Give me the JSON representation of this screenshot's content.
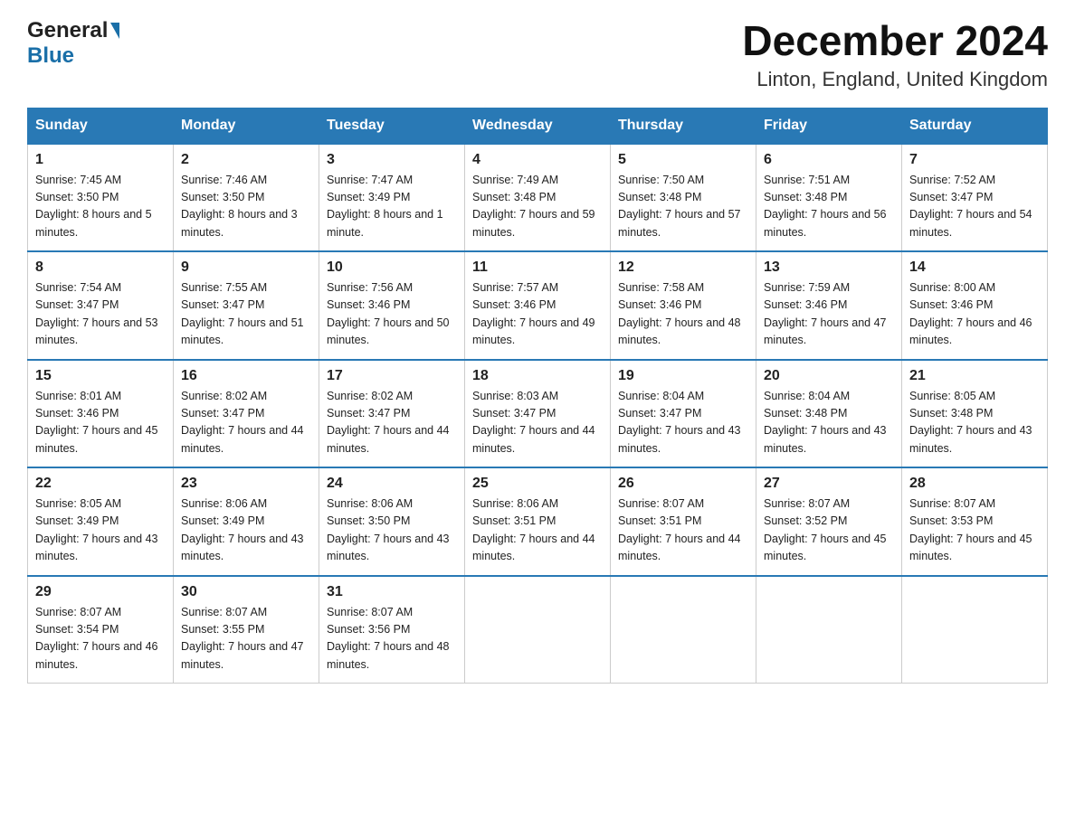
{
  "header": {
    "title": "December 2024",
    "subtitle": "Linton, England, United Kingdom",
    "logo_general": "General",
    "logo_blue": "Blue"
  },
  "days_of_week": [
    "Sunday",
    "Monday",
    "Tuesday",
    "Wednesday",
    "Thursday",
    "Friday",
    "Saturday"
  ],
  "weeks": [
    [
      {
        "day": "1",
        "sunrise": "7:45 AM",
        "sunset": "3:50 PM",
        "daylight": "8 hours and 5 minutes."
      },
      {
        "day": "2",
        "sunrise": "7:46 AM",
        "sunset": "3:50 PM",
        "daylight": "8 hours and 3 minutes."
      },
      {
        "day": "3",
        "sunrise": "7:47 AM",
        "sunset": "3:49 PM",
        "daylight": "8 hours and 1 minute."
      },
      {
        "day": "4",
        "sunrise": "7:49 AM",
        "sunset": "3:48 PM",
        "daylight": "7 hours and 59 minutes."
      },
      {
        "day": "5",
        "sunrise": "7:50 AM",
        "sunset": "3:48 PM",
        "daylight": "7 hours and 57 minutes."
      },
      {
        "day": "6",
        "sunrise": "7:51 AM",
        "sunset": "3:48 PM",
        "daylight": "7 hours and 56 minutes."
      },
      {
        "day": "7",
        "sunrise": "7:52 AM",
        "sunset": "3:47 PM",
        "daylight": "7 hours and 54 minutes."
      }
    ],
    [
      {
        "day": "8",
        "sunrise": "7:54 AM",
        "sunset": "3:47 PM",
        "daylight": "7 hours and 53 minutes."
      },
      {
        "day": "9",
        "sunrise": "7:55 AM",
        "sunset": "3:47 PM",
        "daylight": "7 hours and 51 minutes."
      },
      {
        "day": "10",
        "sunrise": "7:56 AM",
        "sunset": "3:46 PM",
        "daylight": "7 hours and 50 minutes."
      },
      {
        "day": "11",
        "sunrise": "7:57 AM",
        "sunset": "3:46 PM",
        "daylight": "7 hours and 49 minutes."
      },
      {
        "day": "12",
        "sunrise": "7:58 AM",
        "sunset": "3:46 PM",
        "daylight": "7 hours and 48 minutes."
      },
      {
        "day": "13",
        "sunrise": "7:59 AM",
        "sunset": "3:46 PM",
        "daylight": "7 hours and 47 minutes."
      },
      {
        "day": "14",
        "sunrise": "8:00 AM",
        "sunset": "3:46 PM",
        "daylight": "7 hours and 46 minutes."
      }
    ],
    [
      {
        "day": "15",
        "sunrise": "8:01 AM",
        "sunset": "3:46 PM",
        "daylight": "7 hours and 45 minutes."
      },
      {
        "day": "16",
        "sunrise": "8:02 AM",
        "sunset": "3:47 PM",
        "daylight": "7 hours and 44 minutes."
      },
      {
        "day": "17",
        "sunrise": "8:02 AM",
        "sunset": "3:47 PM",
        "daylight": "7 hours and 44 minutes."
      },
      {
        "day": "18",
        "sunrise": "8:03 AM",
        "sunset": "3:47 PM",
        "daylight": "7 hours and 44 minutes."
      },
      {
        "day": "19",
        "sunrise": "8:04 AM",
        "sunset": "3:47 PM",
        "daylight": "7 hours and 43 minutes."
      },
      {
        "day": "20",
        "sunrise": "8:04 AM",
        "sunset": "3:48 PM",
        "daylight": "7 hours and 43 minutes."
      },
      {
        "day": "21",
        "sunrise": "8:05 AM",
        "sunset": "3:48 PM",
        "daylight": "7 hours and 43 minutes."
      }
    ],
    [
      {
        "day": "22",
        "sunrise": "8:05 AM",
        "sunset": "3:49 PM",
        "daylight": "7 hours and 43 minutes."
      },
      {
        "day": "23",
        "sunrise": "8:06 AM",
        "sunset": "3:49 PM",
        "daylight": "7 hours and 43 minutes."
      },
      {
        "day": "24",
        "sunrise": "8:06 AM",
        "sunset": "3:50 PM",
        "daylight": "7 hours and 43 minutes."
      },
      {
        "day": "25",
        "sunrise": "8:06 AM",
        "sunset": "3:51 PM",
        "daylight": "7 hours and 44 minutes."
      },
      {
        "day": "26",
        "sunrise": "8:07 AM",
        "sunset": "3:51 PM",
        "daylight": "7 hours and 44 minutes."
      },
      {
        "day": "27",
        "sunrise": "8:07 AM",
        "sunset": "3:52 PM",
        "daylight": "7 hours and 45 minutes."
      },
      {
        "day": "28",
        "sunrise": "8:07 AM",
        "sunset": "3:53 PM",
        "daylight": "7 hours and 45 minutes."
      }
    ],
    [
      {
        "day": "29",
        "sunrise": "8:07 AM",
        "sunset": "3:54 PM",
        "daylight": "7 hours and 46 minutes."
      },
      {
        "day": "30",
        "sunrise": "8:07 AM",
        "sunset": "3:55 PM",
        "daylight": "7 hours and 47 minutes."
      },
      {
        "day": "31",
        "sunrise": "8:07 AM",
        "sunset": "3:56 PM",
        "daylight": "7 hours and 48 minutes."
      },
      null,
      null,
      null,
      null
    ]
  ]
}
